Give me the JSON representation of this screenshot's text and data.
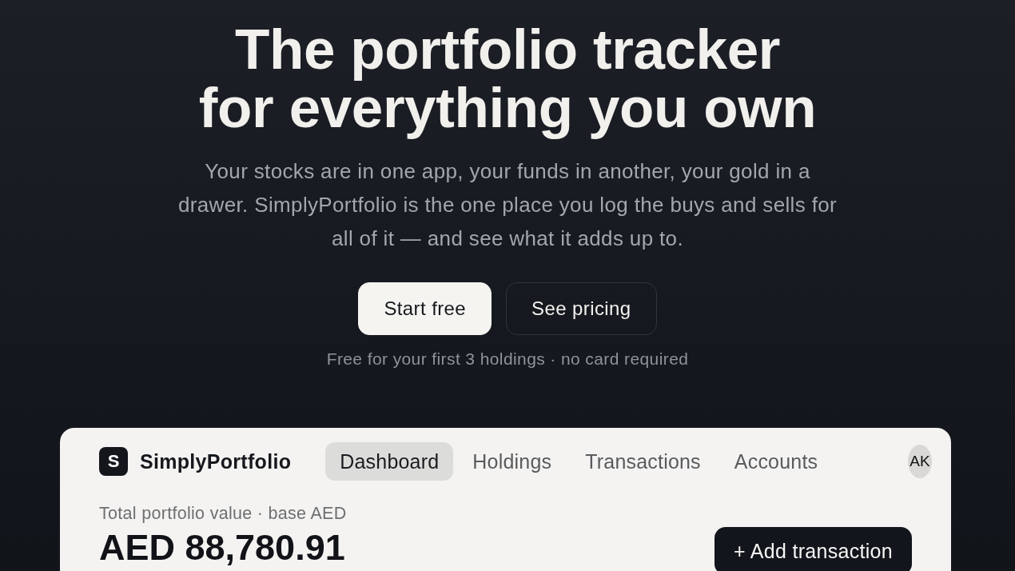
{
  "hero": {
    "headline_lines": [
      "The portfolio tracker",
      "for everything you own"
    ],
    "intro_lines": [
      "Your stocks are in one app, your funds in another, your gold in a",
      "drawer. SimplyPortfolio is the one place you log the buys and sells for",
      "all of it — and see what it adds up to."
    ],
    "buttons": [
      {
        "label": "Start free",
        "kind": "primary"
      },
      {
        "label": "See pricing",
        "kind": "secondary"
      }
    ],
    "note": "Free for your first 3 holdings · no card required"
  },
  "app_preview": {
    "brand": {
      "letter": "S",
      "name": "SimplyPortfolio"
    },
    "tabs": [
      {
        "label": "Dashboard",
        "selected": true
      },
      {
        "label": "Holdings",
        "selected": false
      },
      {
        "label": "Transactions",
        "selected": false
      },
      {
        "label": "Accounts",
        "selected": false
      }
    ],
    "avatar": "AK",
    "summary": {
      "label": "Total portfolio value · base AED",
      "value": "AED 88,780.91"
    },
    "action_button": "+ Add transaction"
  }
}
